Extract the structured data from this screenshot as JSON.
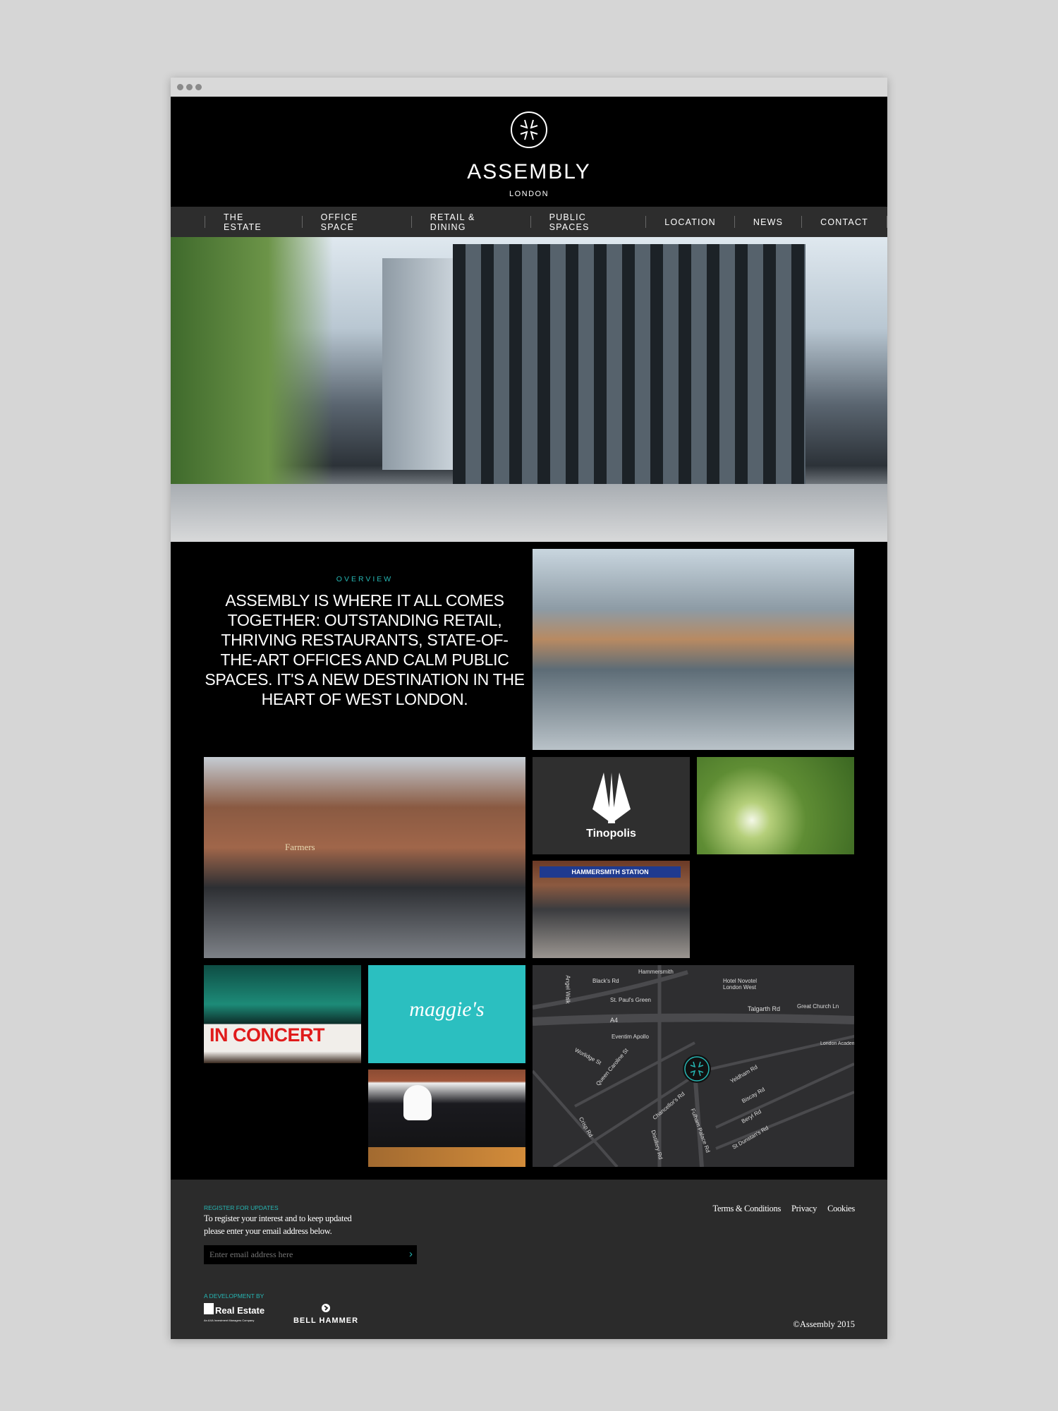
{
  "window": {
    "controls": [
      "close",
      "minimize",
      "maximize"
    ]
  },
  "header": {
    "brand": "ASSEMBLY",
    "subtitle": "LONDON",
    "logo_icon": "assembly-compass-icon"
  },
  "nav": {
    "items": [
      {
        "label": "THE ESTATE"
      },
      {
        "label": "OFFICE SPACE"
      },
      {
        "label": "RETAIL & DINING"
      },
      {
        "label": "PUBLIC SPACES"
      },
      {
        "label": "LOCATION"
      },
      {
        "label": "NEWS"
      },
      {
        "label": "CONTACT"
      }
    ]
  },
  "overview": {
    "label": "OVERVIEW",
    "text": "ASSEMBLY IS WHERE IT ALL COMES TOGETHER: OUTSTANDING RETAIL, THRIVING RESTAURANTS, STATE-OF-THE-ART OFFICES AND CALM PUBLIC SPACES. IT'S A NEW DESTINATION IN THE HEART OF WEST LONDON."
  },
  "tiles": {
    "retail_sign": "Farmers",
    "tinopolis": "Tinopolis",
    "station_sign": "HAMMERSMITH STATION",
    "concert": "IN CONCERT",
    "maggies": "maggie's"
  },
  "map": {
    "labels": [
      "Hammersmith",
      "Black's Rd",
      "Angel Walk",
      "St. Paul's Green",
      "Hotel Novotel London West",
      "Talgarth Rd",
      "Great Church Ln",
      "A4",
      "Eventim Apollo",
      "Worlidge St",
      "Queen Caroline St",
      "London Academy of Music & Drama",
      "Yeldham Rd",
      "Biscay Rd",
      "Beryl Rd",
      "Chancellor's Rd",
      "Crisp Rd",
      "Distillery Rd",
      "Fulham Palace Rd",
      "St Dunstan's Rd"
    ]
  },
  "footer": {
    "register_label": "REGISTER FOR UPDATES",
    "register_line1": "To register your interest and to keep updated",
    "register_line2": "please enter your email address below.",
    "email_placeholder": "Enter email address here",
    "links": [
      "Terms & Conditions",
      "Privacy",
      "Cookies"
    ],
    "dev_label": "A DEVELOPMENT BY",
    "partner1": "Real Estate",
    "partner1_sub": "An AXA Investment Managers Company",
    "partner2": "BELL HAMMER",
    "copyright": "©Assembly 2015"
  },
  "colors": {
    "accent": "#26b6b3",
    "footer_bg": "#2b2b2b",
    "nav_bg": "#2d2d2d"
  }
}
